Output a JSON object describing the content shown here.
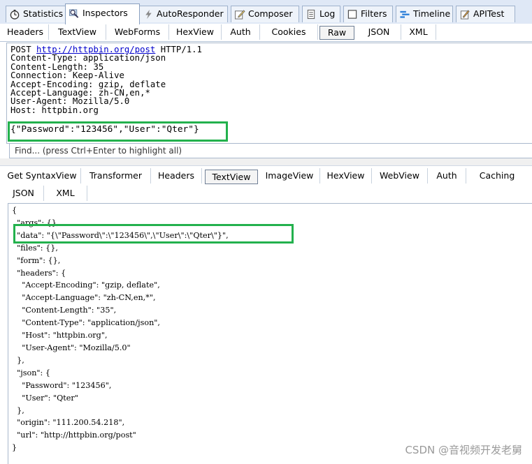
{
  "top_tabs": [
    {
      "label": "Statistics",
      "icon": "stopwatch-icon"
    },
    {
      "label": "Inspectors",
      "icon": "magnifier-icon",
      "active": true
    },
    {
      "label": "AutoResponder",
      "icon": "lightning-icon"
    },
    {
      "label": "Composer",
      "icon": "pencil-icon"
    },
    {
      "label": "Log",
      "icon": "log-icon"
    },
    {
      "label": "Filters",
      "icon": "checkbox-icon"
    },
    {
      "label": "Timeline",
      "icon": "timeline-icon"
    },
    {
      "label": "APITest",
      "icon": "test-icon"
    }
  ],
  "request_tabs": [
    "Headers",
    "TextView",
    "WebForms",
    "HexView",
    "Auth",
    "Cookies",
    "Raw",
    "JSON",
    "XML"
  ],
  "request_selected_tab": "Raw",
  "raw_request": {
    "method": "POST ",
    "url": "http://httpbin.org/post",
    "protocol": " HTTP/1.1",
    "headers": [
      "Content-Type: application/json",
      "Content-Length: 35",
      "Connection: Keep-Alive",
      "Accept-Encoding: gzip, deflate",
      "Accept-Language: zh-CN,en,*",
      "User-Agent: Mozilla/5.0",
      "Host: httpbin.org"
    ],
    "body": "{\"Password\":\"123456\",\"User\":\"Qter\"}"
  },
  "find_placeholder": "Find... (press Ctrl+Enter to highlight all)",
  "response_tabs_row1": [
    "Get SyntaxView",
    "Transformer",
    "Headers",
    "TextView",
    "ImageView",
    "HexView",
    "WebView",
    "Auth",
    "Caching"
  ],
  "response_tabs_row2": [
    "JSON",
    "XML"
  ],
  "response_selected_tab": "TextView",
  "response_lines": [
    "{",
    "  \"args\": {},",
    "  \"data\": \"{\\\"Password\\\":\\\"123456\\\",\\\"User\\\":\\\"Qter\\\"}\",",
    "  \"files\": {},",
    "  \"form\": {},",
    "  \"headers\": {",
    "    \"Accept-Encoding\": \"gzip, deflate\",",
    "    \"Accept-Language\": \"zh-CN,en,*\",",
    "    \"Content-Length\": \"35\",",
    "    \"Content-Type\": \"application/json\",",
    "    \"Host\": \"httpbin.org\",",
    "    \"User-Agent\": \"Mozilla/5.0\"",
    "  },",
    "  \"json\": {",
    "    \"Password\": \"123456\",",
    "    \"User\": \"Qter\"",
    "  },",
    "  \"origin\": \"111.200.54.218\",",
    "  \"url\": \"http://httpbin.org/post\"",
    "}"
  ],
  "watermark": "CSDN @音视频开发老舅",
  "colors": {
    "highlight_box": "#23b14d",
    "link": "#0000cc",
    "tab_strip": "#dfe8f6"
  }
}
